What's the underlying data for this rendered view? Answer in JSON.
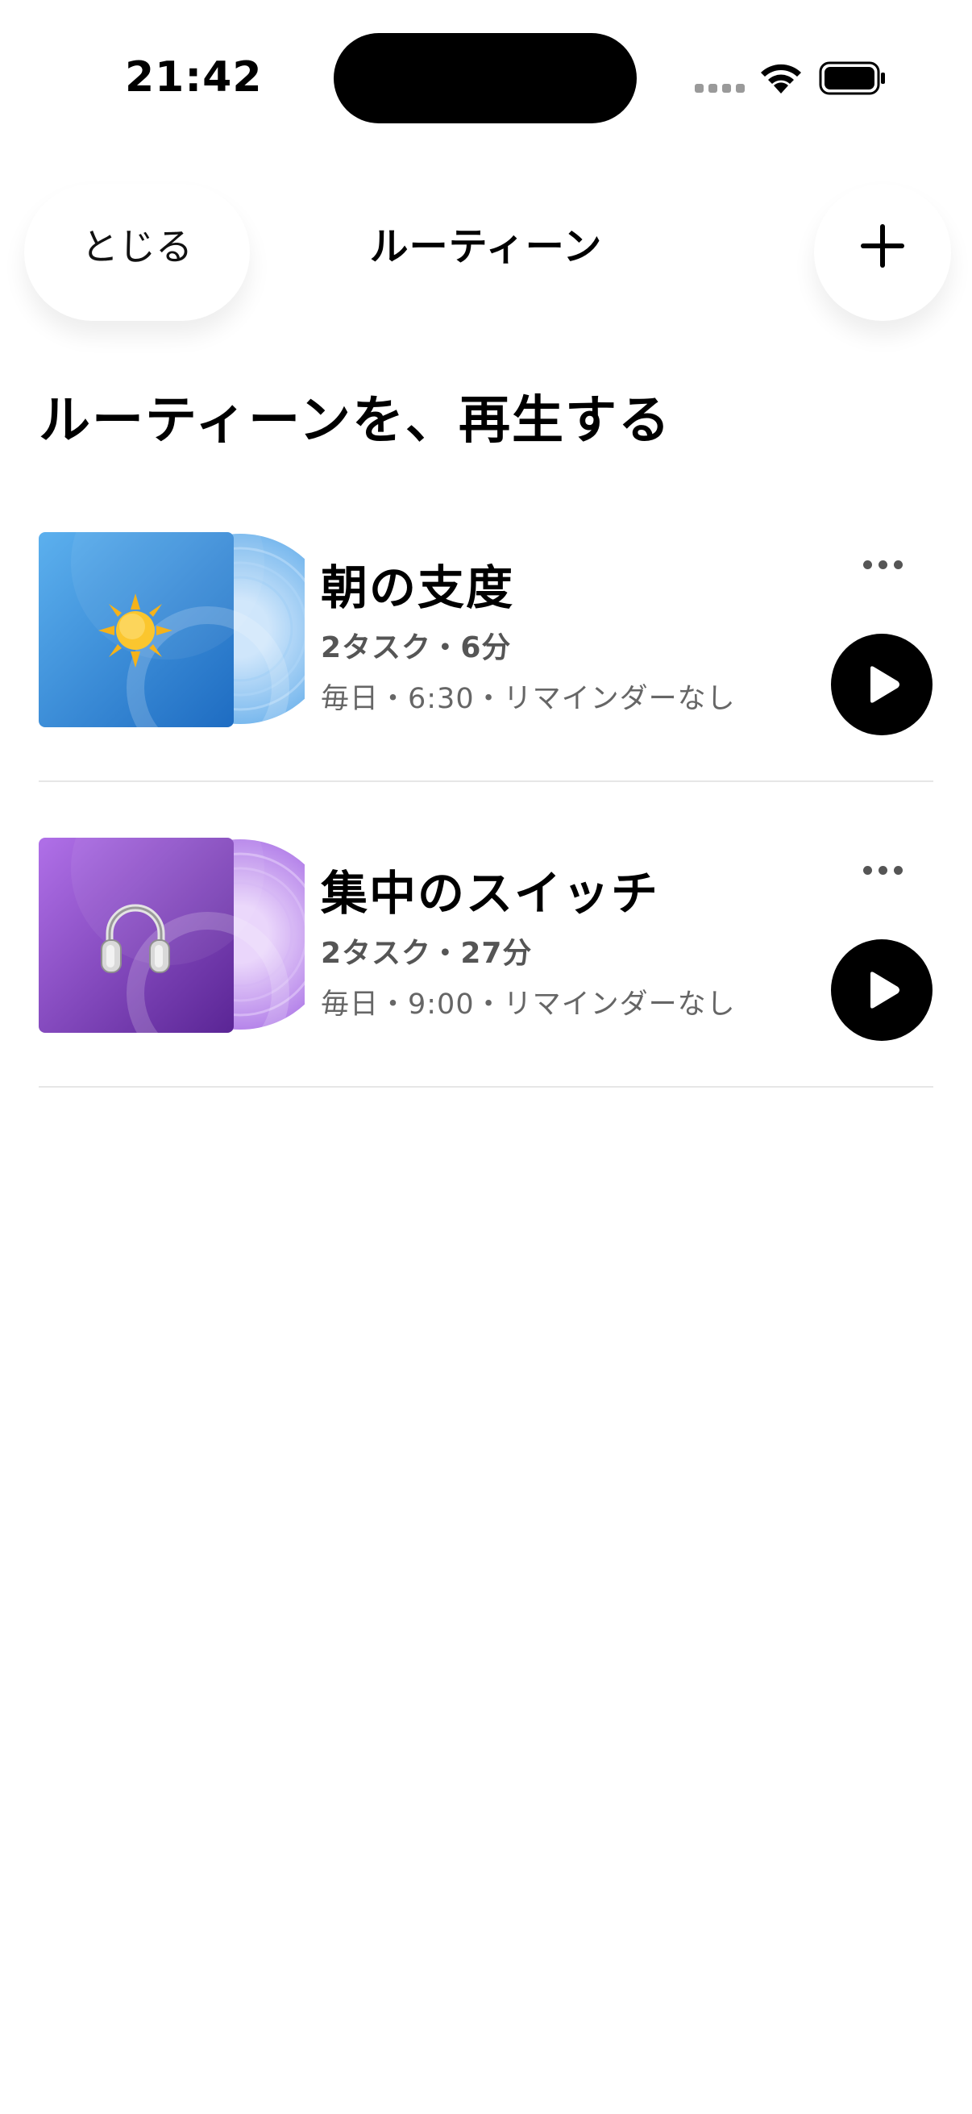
{
  "status_bar": {
    "time": "21:42"
  },
  "nav": {
    "close_label": "とじる",
    "title": "ルーティーン",
    "add_icon": "plus-icon"
  },
  "heading": "ルーティーンを、再生する",
  "routines": [
    {
      "title": "朝の支度",
      "summary": "2タスク・6分",
      "schedule": "毎日・6:30・リマインダーなし",
      "icon": "sun-icon",
      "cover_colors": [
        "#5cb0ee",
        "#1e6cc2"
      ]
    },
    {
      "title": "集中のスイッチ",
      "summary": "2タスク・27分",
      "schedule": "毎日・9:00・リマインダーなし",
      "icon": "headphones-icon",
      "cover_colors": [
        "#b070e8",
        "#5a2595"
      ]
    }
  ]
}
